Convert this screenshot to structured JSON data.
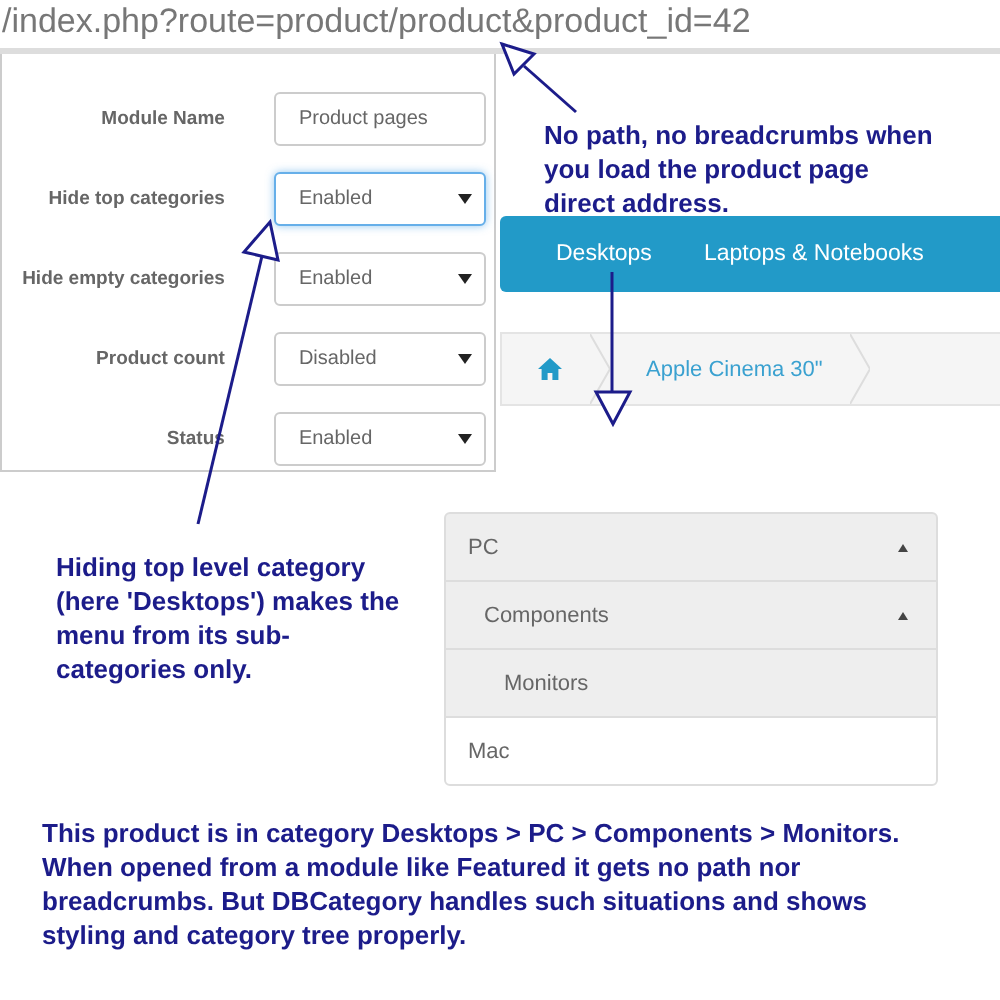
{
  "address_bar": {
    "url": "/index.php?route=product/product&product_id=42"
  },
  "settings_form": {
    "rows": [
      {
        "label": "Module Name",
        "kind": "text",
        "value": "Product pages",
        "focused": false
      },
      {
        "label": "Hide top categories",
        "kind": "select",
        "value": "Enabled",
        "focused": true
      },
      {
        "label": "Hide empty categories",
        "kind": "select",
        "value": "Enabled",
        "focused": false
      },
      {
        "label": "Product count",
        "kind": "select",
        "value": "Disabled",
        "focused": false
      },
      {
        "label": "Status",
        "kind": "select",
        "value": "Enabled",
        "focused": false
      }
    ]
  },
  "note_top": "No path, no breadcrumbs when you load the product page direct address.",
  "store_menu": {
    "items": [
      "Desktops",
      "Laptops & Notebooks"
    ]
  },
  "breadcrumb": {
    "items": [
      "Apple Cinema 30\""
    ]
  },
  "note_left": "Hiding top level category (here 'Desktops') makes the menu from its sub-categories only.",
  "category_tree": [
    {
      "label": "PC",
      "active": true,
      "expanded": true,
      "children": [
        {
          "label": "Components",
          "active": true,
          "expanded": true,
          "children": [
            {
              "label": "Monitors",
              "active": true,
              "expanded": false
            }
          ]
        }
      ]
    },
    {
      "label": "Mac",
      "active": false,
      "expanded": false
    }
  ],
  "note_bottom": "This product is in category Desktops > PC > Components > Monitors. When opened from a module like Featured it gets no path nor breadcrumbs. But DBCategory handles such situations and shows styling and category tree properly."
}
